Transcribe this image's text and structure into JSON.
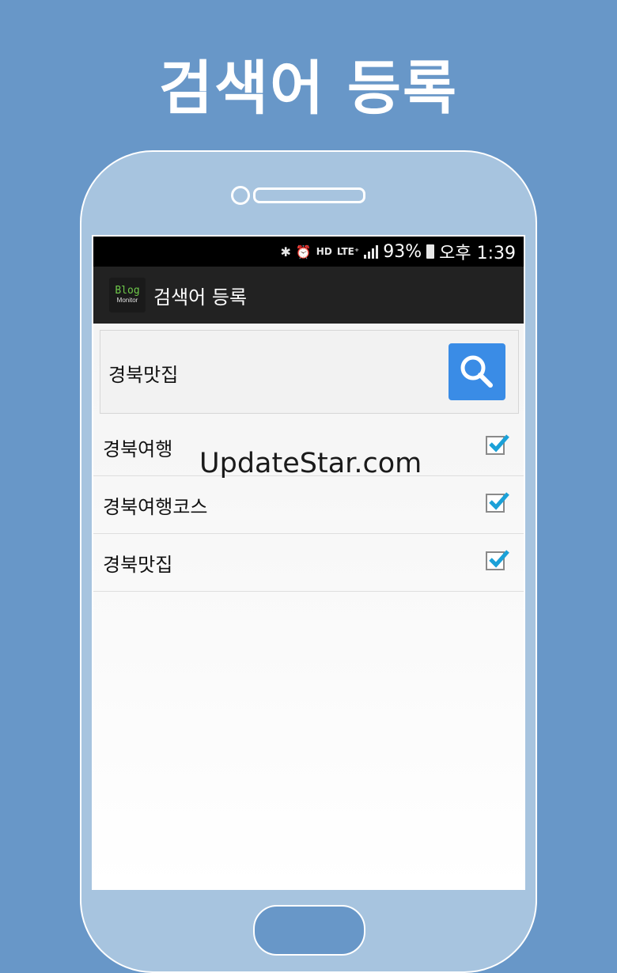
{
  "promo_title": "검색어 등록",
  "status_bar": {
    "icons": [
      "bluetooth-icon",
      "alarm-icon",
      "hd-icon",
      "lte-icon",
      "signal-icon",
      "battery-icon"
    ],
    "lte": "LTE⁺",
    "hd": "HD",
    "battery_percent": "93%",
    "time": "오후 1:39"
  },
  "app": {
    "logo_line1": "Blog",
    "logo_line2": "Monitor",
    "title": "검색어 등록"
  },
  "search": {
    "value": "경북맛집",
    "button_icon": "search-icon",
    "button_color": "#3a8ce6"
  },
  "keywords": [
    {
      "label": "경북여행",
      "checked": true
    },
    {
      "label": "경북여행코스",
      "checked": true
    },
    {
      "label": "경북맛집",
      "checked": true
    }
  ],
  "watermark": "UpdateStar.com",
  "colors": {
    "background": "#6897c8",
    "phone_body": "#a7c4df",
    "action_bar": "#222222",
    "check_accent": "#1ba1d8"
  }
}
